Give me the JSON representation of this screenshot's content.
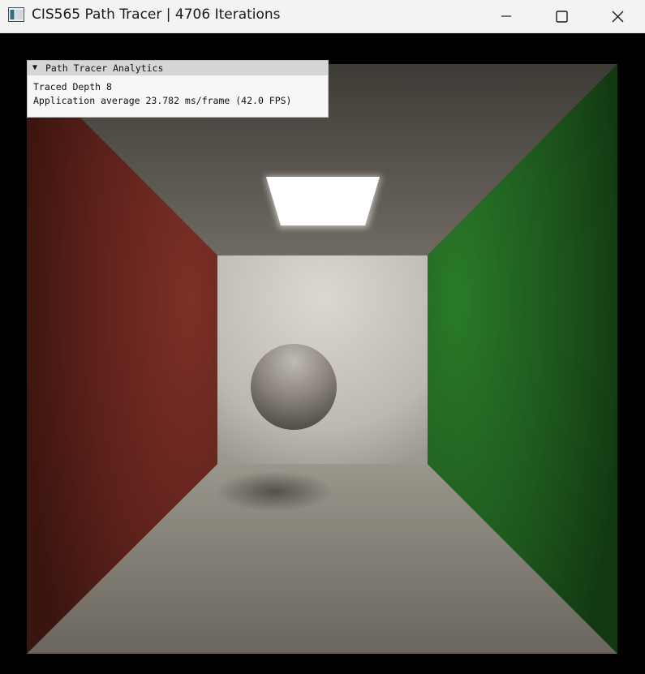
{
  "window": {
    "title": "CIS565 Path Tracer | 4706 Iterations",
    "icon": "app-window-icon",
    "controls": {
      "minimize_icon": "minimize-icon",
      "maximize_icon": "maximize-icon",
      "close_icon": "close-icon"
    }
  },
  "analytics_panel": {
    "title": "Path Tracer Analytics",
    "collapse_glyph": "▼",
    "lines": [
      "Traced Depth 8",
      "Application average 23.782 ms/frame (42.0 FPS)"
    ]
  },
  "scene": {
    "left_wall_color": "#7a2a22",
    "right_wall_color": "#1f6a1f",
    "back_wall_color": "#d8d3cb",
    "ceiling_color": "#5e5a52",
    "floor_color": "#8e8a80",
    "light_color": "#ffffff",
    "sphere_color": "#8a8580"
  }
}
